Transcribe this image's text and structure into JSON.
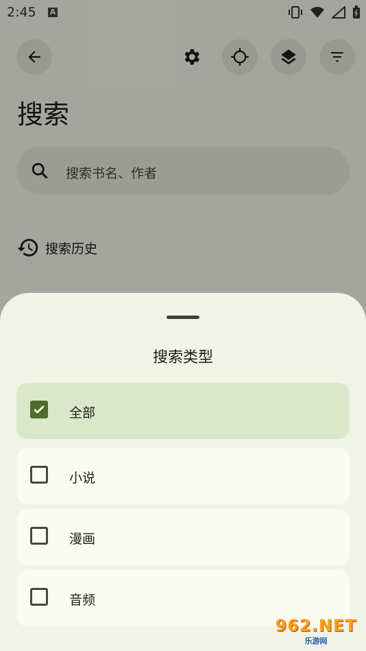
{
  "status_bar": {
    "time": "2:45",
    "notification_icon": "A"
  },
  "toolbar": {
    "back_icon": "arrow-left",
    "settings_icon": "gear",
    "locate_icon": "crosshair",
    "layers_icon": "layers",
    "filter_icon": "filter-lines"
  },
  "page": {
    "title": "搜索",
    "search": {
      "placeholder": "搜索书名、作者"
    },
    "history": {
      "label": "搜索历史"
    }
  },
  "sheet": {
    "title": "搜索类型",
    "options": [
      {
        "label": "全部",
        "checked": true
      },
      {
        "label": "小说",
        "checked": false
      },
      {
        "label": "漫画",
        "checked": false
      },
      {
        "label": "音频",
        "checked": false
      }
    ]
  },
  "watermark": {
    "top": "962.NET",
    "bottom": "乐游网"
  },
  "colors": {
    "accent": "#4e6b2f",
    "selected_bg": "#dbe7c9",
    "sheet_bg": "#f0f3e6"
  }
}
